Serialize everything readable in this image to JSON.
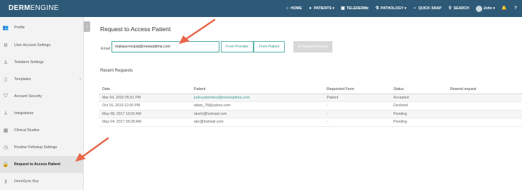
{
  "app": {
    "logo_bold": "DERM",
    "logo_light": "ENGINE"
  },
  "nav": [
    {
      "label": "HOME",
      "icon": "home-icon"
    },
    {
      "label": "PATIENTS ▾",
      "icon": "patients-icon"
    },
    {
      "label": "TELEDERM▾",
      "icon": "telederm-icon"
    },
    {
      "label": "PATHOLOGY ▾",
      "icon": "pathology-icon"
    },
    {
      "label": "QUICK SNAP",
      "icon": "camera-icon"
    },
    {
      "label": "SEARCH",
      "icon": "search-icon"
    },
    {
      "label": "John ▾",
      "icon": "avatar"
    }
  ],
  "sidebar": {
    "items": [
      {
        "label": "Profile",
        "icon": "profile-icon"
      },
      {
        "label": "User Account Settings",
        "icon": "gear-icon"
      },
      {
        "label": "Telederm Settings",
        "icon": "telederm-settings-icon"
      },
      {
        "label": "Templates",
        "icon": "document-icon",
        "has_chevron": true
      },
      {
        "label": "Account Security",
        "icon": "shield-icon"
      },
      {
        "label": "Integrations",
        "icon": "integrations-icon"
      },
      {
        "label": "Clinical Studies",
        "icon": "studies-icon"
      },
      {
        "label": "Routine Followup Settings",
        "icon": "clock-icon"
      },
      {
        "label": "Request to Access Patient",
        "icon": "lock-icon",
        "active": true
      },
      {
        "label": "DermSync Key",
        "icon": "key-icon"
      }
    ]
  },
  "main": {
    "title": "Request to Access Patient",
    "email_label": "Email",
    "email_value": "malopa+mspat@metaoptima.com",
    "btn_from_provider": "From Provider",
    "btn_from_patient": "From Patient",
    "btn_request_access": "✉ Request Access",
    "recent_title": "Recent Requests"
  },
  "table": {
    "headers": [
      "Date",
      "Patient",
      "Requested From",
      "Status",
      "Resend request"
    ],
    "rows": [
      [
        "Mar 04, 2020 05:51 PM",
        "jodi+patienttest@metaoptima.com",
        "Patient",
        "Accepted",
        ""
      ],
      [
        "Oct 16, 2019 12:00 PM",
        "attaic_78@yahoo.com",
        "-",
        "Declined",
        ""
      ],
      [
        "May 08, 2017 10:02 AM",
        "nkorh@hotmail.com",
        "-",
        "Pending",
        ""
      ],
      [
        "May 04, 2017 09:28 AM",
        "abc@hotmail.com",
        "-",
        "Pending",
        ""
      ]
    ]
  },
  "colors": {
    "topbar": "#2e5a77",
    "accent": "#3d9c93",
    "arrow": "#e8664a"
  }
}
